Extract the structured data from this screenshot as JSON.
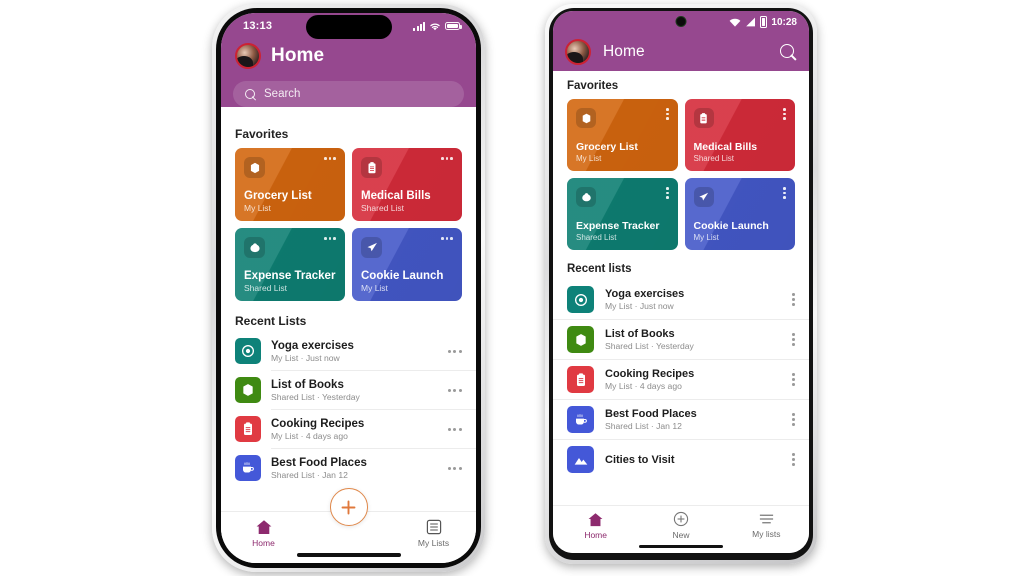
{
  "app": {
    "title": "Home",
    "brand_purple": "#96488F",
    "accent_purple": "#8D2A6E",
    "avatar_ring": "#CC2233",
    "background": "#FFFFFF"
  },
  "iphone": {
    "status": {
      "time": "13:13",
      "signal_icon": "cellular-bars-icon",
      "wifi_icon": "wifi-icon",
      "battery_icon": "battery-icon"
    },
    "header": {
      "avatar": "user-avatar",
      "title": "Home"
    },
    "search": {
      "placeholder": "Search",
      "icon": "search-icon"
    },
    "favorites_title": "Favorites",
    "recent_title": "Recent Lists",
    "nav": [
      {
        "label": "Home",
        "icon": "home-icon",
        "active": true
      },
      {
        "label": "",
        "icon": "plus-fab-icon",
        "active": false
      },
      {
        "label": "My Lists",
        "icon": "list-icon",
        "active": false
      }
    ]
  },
  "android": {
    "status": {
      "time": "10:28",
      "wifi_icon": "wifi-icon",
      "signal_icon": "signal-triangle-icon",
      "battery_icon": "battery-icon"
    },
    "header": {
      "avatar": "user-avatar",
      "title": "Home",
      "search_icon": "search-icon"
    },
    "favorites_title": "Favorites",
    "recent_title": "Recent lists",
    "nav": [
      {
        "label": "Home",
        "icon": "home-icon",
        "active": true
      },
      {
        "label": "New",
        "icon": "plus-circle-icon",
        "active": false
      },
      {
        "label": "My lists",
        "icon": "lists-icon",
        "active": false
      }
    ]
  },
  "favorites": [
    {
      "name": "Grocery List",
      "sub": "My List",
      "color": "#D3660F",
      "icon": "box-icon",
      "menu": "overflow-menu"
    },
    {
      "name": "Medical Bills",
      "sub": "Shared List",
      "color": "#D52B3A",
      "icon": "clipboard-icon",
      "menu": "overflow-menu"
    },
    {
      "name": "Expense Tracker",
      "sub": "Shared List",
      "color": "#0E7F73",
      "icon": "moneybag-icon",
      "menu": "overflow-menu"
    },
    {
      "name": "Cookie Launch",
      "sub": "My List",
      "color": "#4458C8",
      "icon": "rocket-icon",
      "menu": "overflow-menu"
    }
  ],
  "recents": [
    {
      "name": "Yoga exercises",
      "sub": "My List · Just now",
      "color": "#0E8279",
      "icon": "target-icon",
      "menu": "overflow-menu"
    },
    {
      "name": "List of Books",
      "sub": "Shared List · Yesterday",
      "color": "#3F8A12",
      "icon": "box-icon",
      "menu": "overflow-menu"
    },
    {
      "name": "Cooking Recipes",
      "sub": "My List · 4 days ago",
      "color": "#E03A42",
      "icon": "clipboard-icon",
      "menu": "overflow-menu"
    },
    {
      "name": "Best Food Places",
      "sub": "Shared List · Jan 12",
      "color": "#4458D8",
      "icon": "coffee-icon",
      "menu": "overflow-menu"
    },
    {
      "name": "Cities to Visit",
      "sub": "",
      "color": "#4458D8",
      "icon": "mountains-icon",
      "menu": "overflow-menu"
    }
  ]
}
